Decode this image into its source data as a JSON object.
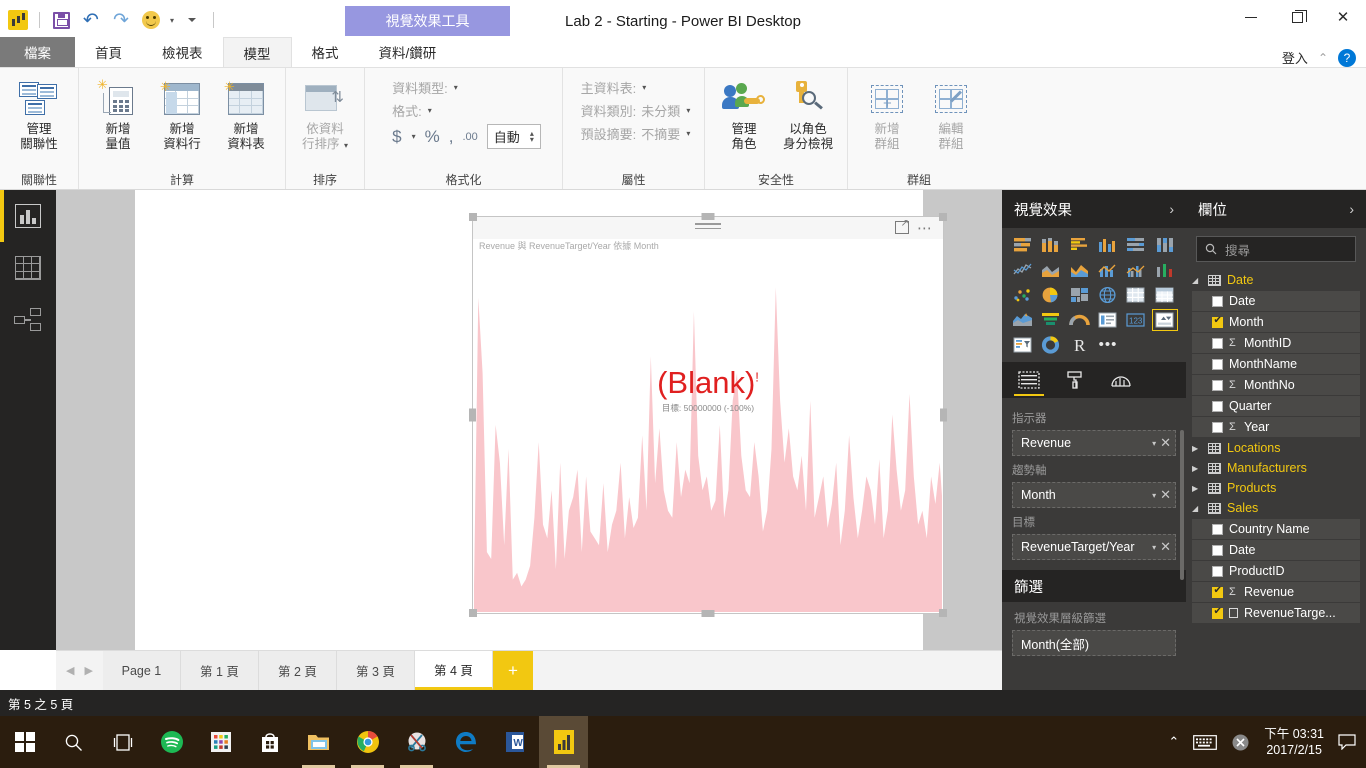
{
  "titlebar": {
    "window_title": "Lab 2 - Starting - Power BI Desktop",
    "contextual_tab": "視覺效果工具",
    "qat": {
      "app_icon": "powerbi-logo-icon",
      "save": "save-icon",
      "undo": "undo-icon",
      "redo": "redo-icon",
      "smiley": "smiley-feedback-icon",
      "customize": "customize-qat-icon"
    },
    "minimize": "minimize-icon",
    "maximize": "maximize-icon",
    "close": "close-icon"
  },
  "ribbon_tabs": {
    "file": "檔案",
    "tabs": [
      "首頁",
      "檢視表",
      "模型",
      "格式",
      "資料/鑽研"
    ],
    "active_tab": "模型",
    "signin": "登入",
    "collapse": "chevron-up-icon",
    "help": "?"
  },
  "ribbon": {
    "groups": [
      {
        "title": "關聯性",
        "buttons": [
          {
            "label_line1": "管理",
            "label_line2": "關聯性",
            "icon": "manage-relationships-icon",
            "disabled": false
          }
        ]
      },
      {
        "title": "計算",
        "buttons": [
          {
            "label_line1": "新增",
            "label_line2": "量值",
            "icon": "new-measure-icon",
            "disabled": false
          },
          {
            "label_line1": "新增",
            "label_line2": "資料行",
            "icon": "new-column-icon",
            "disabled": false
          },
          {
            "label_line1": "新增",
            "label_line2": "資料表",
            "icon": "new-table-icon",
            "disabled": false
          }
        ]
      },
      {
        "title": "排序",
        "buttons": [
          {
            "label_line1": "依資料",
            "label_line2": "行排序",
            "icon": "sort-by-column-icon",
            "disabled": true
          }
        ]
      },
      {
        "title": "格式化",
        "rows": [
          {
            "label": "資料類型:",
            "value": ""
          },
          {
            "label": "格式:",
            "value": ""
          }
        ],
        "symbols": [
          "$",
          "%",
          ",",
          ".00"
        ],
        "auto_value": "自動"
      },
      {
        "title": "屬性",
        "rows": [
          {
            "label": "主資料表:",
            "value": ""
          },
          {
            "label": "資料類別:",
            "value": "未分類"
          },
          {
            "label": "預設摘要:",
            "value": "不摘要"
          }
        ]
      },
      {
        "title": "安全性",
        "buttons": [
          {
            "label_line1": "管理",
            "label_line2": "角色",
            "icon": "manage-roles-icon",
            "disabled": false
          },
          {
            "label_line1": "以角色",
            "label_line2": "身分檢視",
            "icon": "view-as-roles-icon",
            "disabled": false
          }
        ]
      },
      {
        "title": "群組",
        "buttons": [
          {
            "label_line1": "新增",
            "label_line2": "群組",
            "icon": "new-group-icon",
            "disabled": true
          },
          {
            "label_line1": "編輯",
            "label_line2": "群組",
            "icon": "edit-group-icon",
            "disabled": true
          }
        ]
      }
    ]
  },
  "rail": {
    "items": [
      {
        "name": "report-view",
        "icon": "bar-chart-icon",
        "active": true
      },
      {
        "name": "data-view",
        "icon": "table-grid-icon",
        "active": false
      },
      {
        "name": "relationships-view",
        "icon": "model-relationships-icon",
        "active": false
      }
    ]
  },
  "visual": {
    "title": "Revenue 與 RevenueTarget/Year 依據 Month",
    "kpi_value": "(Blank)",
    "kpi_value_superscript": "!",
    "kpi_subtext": "目標: 50000000 (-100%)",
    "value_color": "#e02020",
    "area_color": "#f9c6cb",
    "header_icons": [
      "drag-grip-icon",
      "focus-mode-icon",
      "more-options-icon"
    ]
  },
  "chart_data": {
    "type": "area",
    "title": "Revenue 與 RevenueTarget/Year 依據 Month",
    "xlabel": "Month",
    "ylabel": "Revenue",
    "legend": [
      "Revenue",
      "RevenueTarget/Year"
    ],
    "grid": false,
    "kpi_indicator": "Revenue",
    "kpi_trend_axis": "Month",
    "kpi_target": "RevenueTarget/Year",
    "kpi_displayed_value": "(Blank)",
    "kpi_goal": 50000000,
    "kpi_deviation_pct": -100,
    "values": [
      8,
      92,
      70,
      18,
      16,
      55,
      44,
      20,
      48,
      10,
      12,
      8,
      10,
      14,
      28,
      50,
      26,
      22,
      36,
      13,
      44,
      16,
      30,
      34,
      42,
      18,
      40,
      24,
      22,
      20,
      38,
      18,
      26,
      30,
      44,
      22,
      34,
      25,
      28,
      52,
      30,
      75,
      38,
      54,
      36,
      30,
      28,
      50,
      34,
      42,
      38,
      88,
      46,
      36,
      40,
      30,
      33,
      55,
      28,
      36,
      62,
      70,
      46,
      36,
      34,
      50,
      40,
      24,
      30,
      48,
      95,
      62,
      44,
      54,
      40,
      36,
      46,
      30,
      62,
      28,
      34,
      40,
      25,
      32,
      44,
      20,
      30,
      52,
      34,
      22,
      30,
      40,
      36,
      26,
      45,
      22,
      30,
      58,
      42,
      30,
      36,
      64,
      40,
      26,
      30,
      22,
      40,
      32,
      44,
      26
    ],
    "ylim": [
      0,
      100
    ]
  },
  "viz_pane": {
    "header": "視覺效果",
    "collapse_icon": "chevron-right-icon",
    "icons": [
      "stacked-bar-chart",
      "stacked-column-chart",
      "clustered-bar-chart",
      "clustered-column-chart",
      "100-stacked-bar-chart",
      "100-stacked-column-chart",
      "line-chart",
      "area-chart",
      "stacked-area-chart",
      "line-stacked-column-chart",
      "line-clustered-column-chart",
      "ribbon-chart",
      "scatter-chart",
      "pie-chart",
      "treemap",
      "map",
      "matrix",
      "table",
      "filled-map",
      "funnel",
      "gauge",
      "multi-row-card",
      "card",
      "kpi",
      "slicer",
      "donut-chart",
      "r-script-visual",
      "more-visuals"
    ],
    "selected_icon": "kpi",
    "tabs": [
      "fields-tab",
      "format-tab",
      "analytics-tab"
    ],
    "active_tab": "fields-tab",
    "wells": [
      {
        "label": "指示器",
        "value": "Revenue"
      },
      {
        "label": "趨勢軸",
        "value": "Month"
      },
      {
        "label": "目標",
        "value": "RevenueTarget/Year"
      }
    ],
    "filters": {
      "header": "篩選",
      "subtitle": "視覺效果層級篩選",
      "items": [
        "Month(全部)"
      ]
    }
  },
  "fields_pane": {
    "header": "欄位",
    "collapse_icon": "chevron-right-icon",
    "search_placeholder": "搜尋",
    "tables": [
      {
        "name": "Date",
        "expanded": true,
        "fields": [
          {
            "name": "Date",
            "checked": false,
            "measure": false,
            "calc": false
          },
          {
            "name": "Month",
            "checked": true,
            "measure": false,
            "calc": false
          },
          {
            "name": "MonthID",
            "checked": false,
            "measure": true,
            "calc": false
          },
          {
            "name": "MonthName",
            "checked": false,
            "measure": false,
            "calc": false
          },
          {
            "name": "MonthNo",
            "checked": false,
            "measure": true,
            "calc": false
          },
          {
            "name": "Quarter",
            "checked": false,
            "measure": false,
            "calc": false
          },
          {
            "name": "Year",
            "checked": false,
            "measure": true,
            "calc": false
          }
        ]
      },
      {
        "name": "Locations",
        "expanded": false,
        "fields": []
      },
      {
        "name": "Manufacturers",
        "expanded": false,
        "fields": []
      },
      {
        "name": "Products",
        "expanded": false,
        "fields": []
      },
      {
        "name": "Sales",
        "expanded": true,
        "fields": [
          {
            "name": "Country Name",
            "checked": false,
            "measure": false,
            "calc": false
          },
          {
            "name": "Date",
            "checked": false,
            "measure": false,
            "calc": false
          },
          {
            "name": "ProductID",
            "checked": false,
            "measure": false,
            "calc": false
          },
          {
            "name": "Revenue",
            "checked": true,
            "measure": true,
            "calc": false
          },
          {
            "name": "RevenueTarge...",
            "checked": true,
            "measure": false,
            "calc": true
          }
        ]
      }
    ]
  },
  "page_tabs": {
    "prev_icon": "prev-page-icon",
    "next_icon": "next-page-icon",
    "tabs": [
      "Page 1",
      "第 1 頁",
      "第 2 頁",
      "第 3 頁",
      "第 4 頁"
    ],
    "active_tab": "第 4 頁",
    "add_label": "+"
  },
  "status_bar": {
    "text": "第 5 之 5 頁"
  },
  "taskbar": {
    "items": [
      {
        "name": "start-button",
        "icon": "windows-logo-icon"
      },
      {
        "name": "search-button",
        "icon": "search-icon"
      },
      {
        "name": "task-view-button",
        "icon": "task-view-icon"
      },
      {
        "name": "spotify-button",
        "icon": "spotify-icon"
      },
      {
        "name": "apps-button",
        "icon": "apps-grid-icon"
      },
      {
        "name": "store-button",
        "icon": "store-bag-icon"
      },
      {
        "name": "file-explorer-button",
        "icon": "folder-icon"
      },
      {
        "name": "chrome-button",
        "icon": "chrome-icon"
      },
      {
        "name": "snipping-tool-button",
        "icon": "scissors-icon"
      },
      {
        "name": "edge-button",
        "icon": "edge-icon"
      },
      {
        "name": "word-button",
        "icon": "word-icon"
      },
      {
        "name": "powerbi-button",
        "icon": "powerbi-icon"
      }
    ],
    "tray": {
      "chevron": "show-hidden-icons-icon",
      "keyboard": "touch-keyboard-icon",
      "close_x": "close-tray-icon",
      "time": "下午 03:31",
      "date": "2017/2/15",
      "action_center": "action-center-icon"
    }
  }
}
